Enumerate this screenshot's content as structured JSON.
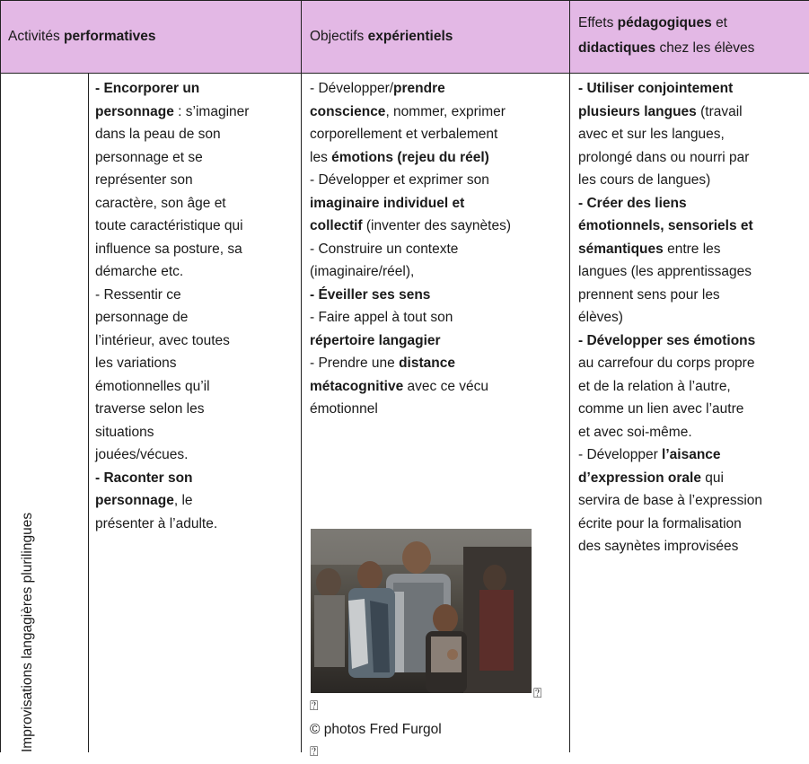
{
  "header": {
    "col1_prefix": "Activités",
    "col1_bold": "performatives",
    "col2_prefix": "Objectifs",
    "col2_bold": "expérientiels",
    "col3_line1_prefix": "Effets",
    "col3_line1_bold": "pédagogiques",
    "col3_line1_suffix": "et",
    "col3_line2_bold": "didactiques",
    "col3_line2_suffix": "chez les élèves"
  },
  "row_label": "Improvisations langagières plurilingues",
  "activities": [
    {
      "bold": "- Encorporer un",
      "text": ""
    },
    {
      "bold": "personnage",
      "text": " : s’imaginer"
    },
    {
      "text": "dans la peau de son"
    },
    {
      "text": "personnage et se"
    },
    {
      "text": "représenter son"
    },
    {
      "text": "caractère, son âge et"
    },
    {
      "text": "toute caractéristique qui"
    },
    {
      "text": "influence sa posture, sa"
    },
    {
      "text": "démarche etc."
    },
    {
      "text": "- Ressentir ce"
    },
    {
      "text": "personnage de"
    },
    {
      "text": "l’intérieur, avec toutes"
    },
    {
      "text": "les variations"
    },
    {
      "text": "émotionnelles qu’il"
    },
    {
      "text": "traverse selon les"
    },
    {
      "text": "situations"
    },
    {
      "text": "jouées/vécues."
    },
    {
      "bold": "- Raconter son",
      "text": ""
    },
    {
      "bold": "personnage",
      "text": ", le"
    },
    {
      "text": "présenter à l’adulte."
    }
  ],
  "objectives": [
    {
      "text": "- Développer/",
      "bold": "prendre"
    },
    {
      "bold": "conscience",
      "text": ", nommer, exprimer"
    },
    {
      "text": "corporellement et verbalement"
    },
    {
      "text": "les ",
      "bold": "émotions (rejeu du réel)"
    },
    {
      "text": "- Développer et exprimer son"
    },
    {
      "bold": "imaginaire individuel et"
    },
    {
      "bold": "collectif",
      "text": " (inventer des saynètes)"
    },
    {
      "text": "- Construire un contexte"
    },
    {
      "text": "(imaginaire/réel),"
    },
    {
      "bold": "- Éveiller ses sens"
    },
    {
      "text": "- Faire appel à tout son"
    },
    {
      "bold": "répertoire langagier"
    },
    {
      "text": "- Prendre une ",
      "bold": "distance"
    },
    {
      "bold": "métacognitive",
      "text": " avec ce vécu"
    },
    {
      "text": "émotionnel"
    }
  ],
  "photo_credit": "© photos Fred Furgol",
  "effects": [
    {
      "bold": "- Utiliser conjointement"
    },
    {
      "bold": "plusieurs langues",
      "text": " (travail"
    },
    {
      "text": "avec et sur les langues,"
    },
    {
      "text": "prolongé dans ou nourri par"
    },
    {
      "text": "les cours de langues)"
    },
    {
      "bold": "- Créer des liens"
    },
    {
      "bold": "émotionnels, sensoriels et"
    },
    {
      "bold": "sémantiques",
      "text": " entre les"
    },
    {
      "text": "langues (les apprentissages"
    },
    {
      "text": "prennent sens pour les"
    },
    {
      "text": "élèves)"
    },
    {
      "bold": "- Développer ses émotions"
    },
    {
      "text": "au carrefour du corps propre"
    },
    {
      "text": "et de la relation à l’autre,"
    },
    {
      "text": "comme un lien avec l’autre"
    },
    {
      "text": "et avec soi-même."
    },
    {
      "text": "- Développer ",
      "bold": "l’aisance"
    },
    {
      "bold": "d’expression orale",
      "text": " qui"
    },
    {
      "text": "servira de base à l’expression"
    },
    {
      "text": "écrite pour la formalisation"
    },
    {
      "text": "des saynètes improvisées"
    }
  ]
}
